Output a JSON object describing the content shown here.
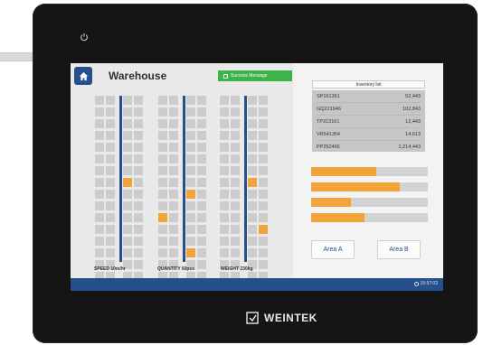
{
  "header": {
    "title": "Warehouse",
    "toast": "Success Message"
  },
  "labels": {
    "speed": "SPEED 10m/hr",
    "quantity": "QUANTITY 60pcs",
    "weight": "WEIGHT 230kg"
  },
  "inventory": {
    "title": "Inventory list",
    "rows": [
      {
        "id": "SP161361",
        "value": "52,443"
      },
      {
        "id": "GQ221646",
        "value": "102,843"
      },
      {
        "id": "TP313161",
        "value": "12,443"
      },
      {
        "id": "VR541354",
        "value": "14,613"
      },
      {
        "id": "PP252465",
        "value": "1,214,443"
      }
    ]
  },
  "progress": [
    0.56,
    0.76,
    0.34,
    0.46
  ],
  "buttons": {
    "area_a": "Area A",
    "area_b": "Area B"
  },
  "status": {
    "time": "15:57:02"
  },
  "brand": "WEINTEK",
  "colors": {
    "accent": "#26508c",
    "orange": "#f0a43a",
    "success": "#3bb449"
  },
  "grids": [
    {
      "on": [
        [
          7,
          1
        ],
        [
          16,
          0
        ],
        [
          16,
          1
        ]
      ]
    },
    {
      "on": [
        [
          10,
          0
        ],
        [
          8,
          1
        ],
        [
          13,
          1
        ]
      ]
    },
    {
      "on": [
        [
          7,
          0
        ],
        [
          11,
          1
        ],
        [
          16,
          0
        ]
      ]
    }
  ]
}
